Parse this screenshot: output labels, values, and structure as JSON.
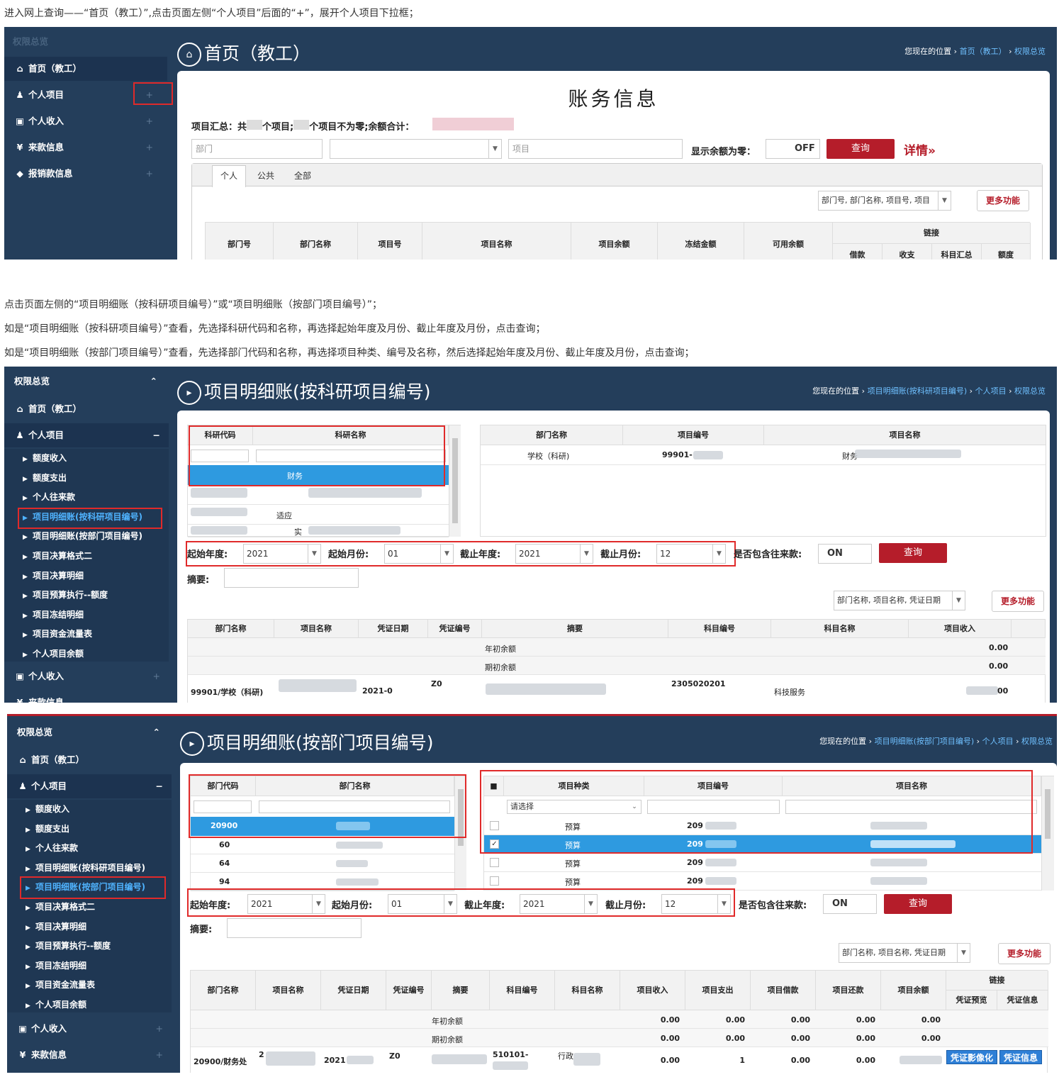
{
  "instructions": {
    "step1": "进入网上查询——“首页（教工）”,点击页面左侧“个人项目”后面的“+”，展开个人项目下拉框；",
    "step2": "点击页面左侧的“项目明细账（按科研项目编号）”或“项目明细账（按部门项目编号）”；",
    "step3": "如是“项目明细账（按科研项目编号）”查看，先选择科研代码和名称，再选择起始年度及月份、截止年度及月份，点击查询；",
    "step4": "如是“项目明细账（按部门项目编号）”查看，先选择部门代码和名称，再选择项目种类、编号及名称，然后选择起始年度及月份、截止年度及月份，点击查询；"
  },
  "colors": {
    "sidebar": "#243e5b",
    "accent": "#b51d2a",
    "highlight": "#e02a2a",
    "selected": "#2e9ae0"
  },
  "shot1": {
    "sidebar": {
      "header": "权限总览",
      "items": [
        {
          "icon": "home-icon",
          "glyph": "🏠",
          "label": "首页（教工）"
        },
        {
          "icon": "user-icon",
          "glyph": "👤",
          "label": "个人项目",
          "plus": "+"
        },
        {
          "icon": "money-icon",
          "glyph": "▣",
          "label": "个人收入",
          "plus": "+"
        },
        {
          "icon": "yen-icon",
          "glyph": "¥",
          "label": "来款信息",
          "plus": "+"
        },
        {
          "icon": "tag-icon",
          "glyph": "◆",
          "label": "报销款信息",
          "plus": "+"
        }
      ]
    },
    "title": "首页（教工）",
    "crumb": {
      "prefix": "您现在的位置 ›",
      "links": [
        "首页（教工）",
        "权限总览"
      ]
    },
    "heading": "账务信息",
    "summary": {
      "a": "项目汇总：共",
      "b": "个项目;",
      "c": "个项目不为零;余额合计："
    },
    "dept_placeholder": "部门",
    "project_placeholder": "项目",
    "zero_label": "显示余额为零：",
    "toggle": "OFF",
    "query": "查询",
    "detail": "详情»",
    "tabs": [
      "个人",
      "公共",
      "全部"
    ],
    "search_select": "部门号, 部门名称, 项目号, 项目",
    "more": "更多功能",
    "columns": [
      "部门号",
      "部门名称",
      "项目号",
      "项目名称",
      "项目余额",
      "冻结金额",
      "可用余额"
    ],
    "link_group": "链接",
    "link_cols": [
      "借款",
      "收支",
      "科目汇总",
      "额度"
    ]
  },
  "shot2": {
    "sidebar": {
      "header": "权限总览",
      "collapse": "⌃",
      "home": "首页（教工）",
      "personal": "个人项目",
      "minus": "−",
      "subs": [
        "额度收入",
        "额度支出",
        "个人往来款",
        "项目明细账(按科研项目编号)",
        "项目明细账(按部门项目编号)",
        "项目决算格式二",
        "项目决算明细",
        "项目预算执行--额度",
        "项目冻结明细",
        "项目资金流量表",
        "个人项目余额"
      ],
      "income": "个人收入",
      "funds": "来款信息"
    },
    "title": "项目明细账(按科研项目编号)",
    "crumb": {
      "prefix": "您现在的位置 ›",
      "links": [
        "项目明细账(按科研项目编号)",
        "个人项目",
        "权限总览"
      ]
    },
    "left_cols": [
      "科研代码",
      "科研名称"
    ],
    "left_rows": [
      "财务",
      "",
      "适应",
      "实"
    ],
    "right_cols": [
      "部门名称",
      "项目编号",
      "项目名称"
    ],
    "right_row": {
      "dept": "学校（科研)",
      "code": "99901-",
      "name": "财务"
    },
    "filters": {
      "start_year_label": "起始年度:",
      "start_year": "2021",
      "start_month_label": "起始月份:",
      "start_month": "01",
      "end_year_label": "截止年度:",
      "end_year": "2021",
      "end_month_label": "截止月份:",
      "end_month": "12",
      "incl_label": "是否包含往来款:",
      "toggle": "ON",
      "query": "查询"
    },
    "summary_label": "摘要:",
    "search_select": "部门名称, 项目名称, 凭证日期",
    "more": "更多功能",
    "columns": [
      "部门名称",
      "项目名称",
      "凭证日期",
      "凭证编号",
      "摘要",
      "科目编号",
      "科目名称",
      "项目收入"
    ],
    "rows": [
      {
        "summary": "年初余额",
        "income": "0.00"
      },
      {
        "summary": "期初余额",
        "income": "0.00"
      },
      {
        "dept": "99901/学校（科研)",
        "date": "2021-0",
        "voucher": "Z0",
        "code": "2305020201",
        "subject": "科技服务",
        "income": "00"
      }
    ]
  },
  "shot3": {
    "sidebar": {
      "header": "权限总览",
      "collapse": "⌃",
      "home": "首页（教工）",
      "personal": "个人项目",
      "minus": "−",
      "subs": [
        "额度收入",
        "额度支出",
        "个人往来款",
        "项目明细账(按科研项目编号)",
        "项目明细账(按部门项目编号)",
        "项目决算格式二",
        "项目决算明细",
        "项目预算执行--额度",
        "项目冻结明细",
        "项目资金流量表",
        "个人项目余额"
      ],
      "income": "个人收入",
      "funds": "来款信息"
    },
    "title": "项目明细账(按部门项目编号)",
    "crumb": {
      "prefix": "您现在的位置 ›",
      "links": [
        "项目明细账(按部门项目编号)",
        "个人项目",
        "权限总览"
      ]
    },
    "left_cols": [
      "部门代码",
      "部门名称"
    ],
    "left_rows": [
      "20900",
      "60",
      "64",
      "94"
    ],
    "right_cols": [
      "项目种类",
      "项目编号",
      "项目名称"
    ],
    "right_filter": "请选择",
    "right_rows": [
      {
        "type": "预算",
        "code": "209"
      },
      {
        "type": "预算",
        "code": "209"
      },
      {
        "type": "预算",
        "code": "209"
      },
      {
        "type": "预算",
        "code": "209"
      }
    ],
    "filters": {
      "start_year_label": "起始年度:",
      "start_year": "2021",
      "start_month_label": "起始月份:",
      "start_month": "01",
      "end_year_label": "截止年度:",
      "end_year": "2021",
      "end_month_label": "截止月份:",
      "end_month": "12",
      "incl_label": "是否包含往来款:",
      "toggle": "ON",
      "query": "查询"
    },
    "summary_label": "摘要:",
    "search_select": "部门名称, 项目名称, 凭证日期",
    "more": "更多功能",
    "columns": [
      "部门名称",
      "项目名称",
      "凭证日期",
      "凭证编号",
      "摘要",
      "科目编号",
      "科目名称",
      "项目收入",
      "项目支出",
      "项目借款",
      "项目还款",
      "项目余额"
    ],
    "link_group": "链接",
    "link_cols": [
      "凭证预览",
      "凭证信息"
    ],
    "rows": [
      {
        "summary": "年初余额",
        "vals": [
          "0.00",
          "0.00",
          "0.00",
          "0.00",
          "0.00"
        ]
      },
      {
        "summary": "期初余额",
        "vals": [
          "0.00",
          "0.00",
          "0.00",
          "0.00",
          "0.00"
        ]
      },
      {
        "dept": "20900/财务处",
        "name": "2",
        "date": "2021",
        "voucher": "Z0",
        "code": "510101-",
        "subject": "行政",
        "vals": [
          "0.00",
          "1",
          "0.00",
          "0.00",
          ""
        ],
        "btn1": "凭证影像化",
        "btn2": "凭证信息"
      }
    ]
  }
}
